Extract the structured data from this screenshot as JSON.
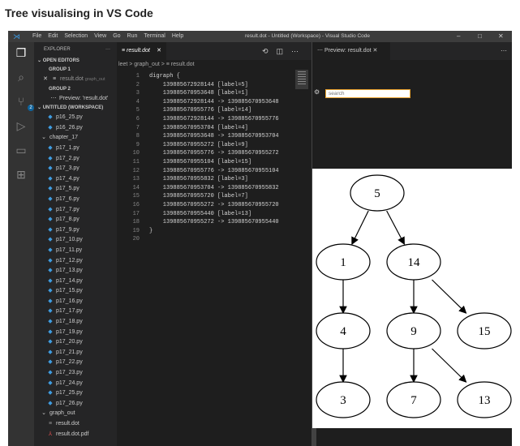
{
  "caption": "Tree visualising in VS Code",
  "titlebar": {
    "menu": [
      "File",
      "Edit",
      "Selection",
      "View",
      "Go",
      "Run",
      "Terminal",
      "Help"
    ],
    "window_title": "result.dot - Untitled (Workspace) - Visual Studio Code",
    "minimize": "–",
    "maximize": "□",
    "close": "✕"
  },
  "activity_bar": [
    "files-icon",
    "search-icon",
    "source-control-icon",
    "run-icon",
    "remote-explorer-icon",
    "extensions-icon"
  ],
  "scm_badge": "2",
  "explorer": {
    "header": "EXPLORER",
    "more": "···",
    "open_editors": "OPEN EDITORS",
    "group1": "GROUP 1",
    "group1_file": "result.dot",
    "group1_path": "graph_out",
    "group2": "GROUP 2",
    "group2_file": "Preview: 'result.dot'",
    "workspace": "UNTITLED (WORKSPACE)",
    "files_top": [
      "p16_25.py",
      "p16_26.py"
    ],
    "folder_chapter": "chapter_17",
    "chapter_files": [
      "p17_1.py",
      "p17_2.py",
      "p17_3.py",
      "p17_4.py",
      "p17_5.py",
      "p17_6.py",
      "p17_7.py",
      "p17_8.py",
      "p17_9.py",
      "p17_10.py",
      "p17_11.py",
      "p17_12.py",
      "p17_13.py",
      "p17_14.py",
      "p17_15.py",
      "p17_16.py",
      "p17_17.py",
      "p17_18.py",
      "p17_19.py",
      "p17_20.py",
      "p17_21.py",
      "p17_22.py",
      "p17_23.py",
      "p17_24.py",
      "p17_25.py",
      "p17_26.py"
    ],
    "folder_graph": "graph_out",
    "graph_files": [
      "result.dot",
      "result.dot.pdf"
    ]
  },
  "editor": {
    "tab_label": "result.dot",
    "breadcrumb": "leet > graph_out > ≡ result.dot",
    "lines": [
      "digraph {",
      "    139885672928144 [label=5]",
      "    139885670953648 [label=1]",
      "    139885672928144 -> 139885670953648",
      "    139885670955776 [label=14]",
      "    139885672928144 -> 139885670955776",
      "    139885670953704 [label=4]",
      "    139885670953648 -> 139885670953704",
      "    139885670955272 [label=9]",
      "    139885670955776 -> 139885670955272",
      "    139885670955104 [label=15]",
      "    139885670955776 -> 139885670955104",
      "    139885670955832 [label=3]",
      "    139885670953704 -> 139885670955832",
      "    139885670955720 [label=7]",
      "    139885670955272 -> 139885670955720",
      "    139885670955440 [label=13]",
      "    139885670955272 -> 139885670955440",
      "}",
      ""
    ]
  },
  "preview": {
    "tab_label": "Preview: result.dot",
    "search_placeholder": "search",
    "nodes": [
      "5",
      "1",
      "14",
      "4",
      "9",
      "15",
      "3",
      "7",
      "13"
    ]
  }
}
